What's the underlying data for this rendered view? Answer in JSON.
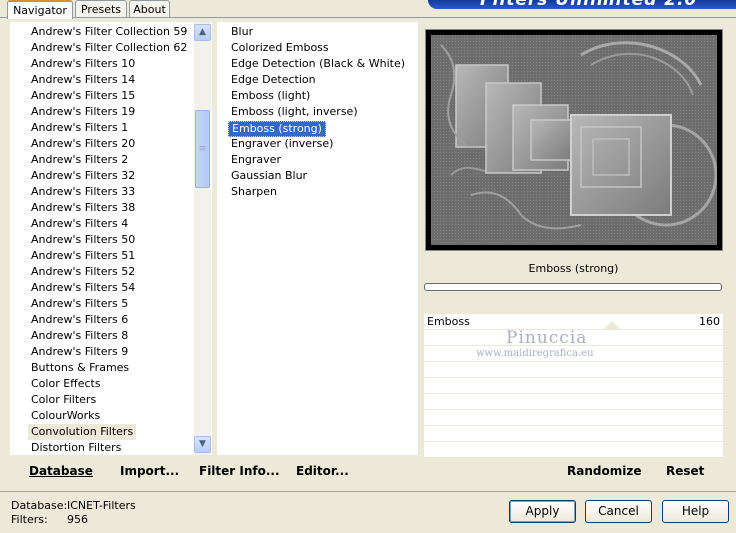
{
  "tabs": [
    {
      "label": "Navigator",
      "active": true
    },
    {
      "label": "Presets",
      "active": false
    },
    {
      "label": "About",
      "active": false
    }
  ],
  "banner_text": "Filters Unlimited 2.0",
  "categories": {
    "items": [
      "Andrew's Filter Collection 59",
      "Andrew's Filter Collection 62",
      "Andrew's Filters 10",
      "Andrew's Filters 14",
      "Andrew's Filters 15",
      "Andrew's Filters 19",
      "Andrew's Filters 1",
      "Andrew's Filters 20",
      "Andrew's Filters 2",
      "Andrew's Filters 32",
      "Andrew's Filters 33",
      "Andrew's Filters 38",
      "Andrew's Filters 4",
      "Andrew's Filters 50",
      "Andrew's Filters 51",
      "Andrew's Filters 52",
      "Andrew's Filters 54",
      "Andrew's Filters 5",
      "Andrew's Filters 6",
      "Andrew's Filters 8",
      "Andrew's Filters 9",
      "Buttons & Frames",
      "Color Effects",
      "Color Filters",
      "ColourWorks",
      "Convolution Filters",
      "Distortion Filters"
    ],
    "selected": "Convolution Filters"
  },
  "filters": {
    "items": [
      "Blur",
      "Colorized Emboss",
      "Edge Detection (Black & White)",
      "Edge Detection",
      "Emboss (light)",
      "Emboss (light, inverse)",
      "Emboss (strong)",
      "Engraver (inverse)",
      "Engraver",
      "Gaussian Blur",
      "Sharpen"
    ],
    "selected": "Emboss (strong)"
  },
  "bottom_left": {
    "database": "Database",
    "import": "Import...",
    "filter_info": "Filter Info...",
    "editor": "Editor..."
  },
  "preview": {
    "filter_name": "Emboss (strong)",
    "param_label": "Emboss",
    "param_value": "160",
    "watermark_name": "Pinuccia",
    "watermark_url": "www.maidiregrafica.eu"
  },
  "bottom_right": {
    "randomize": "Randomize",
    "reset": "Reset"
  },
  "status": {
    "database_label": "Database:",
    "database_value": "ICNET-Filters",
    "filters_label": "Filters:",
    "filters_value": "956"
  },
  "buttons": {
    "apply": "Apply",
    "cancel": "Cancel",
    "help": "Help"
  }
}
